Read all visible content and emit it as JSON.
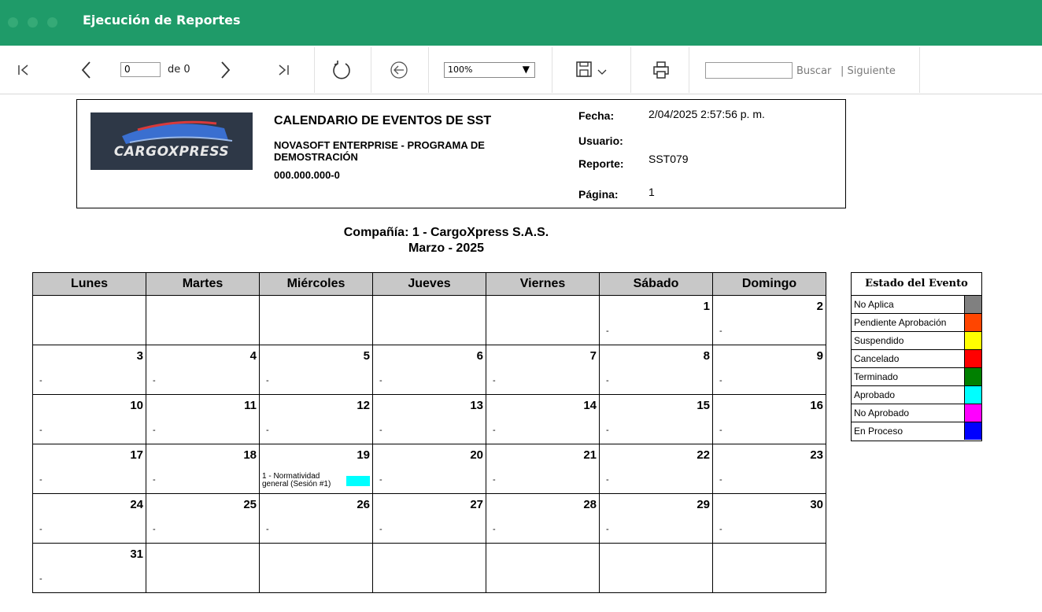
{
  "window": {
    "title": "Ejecución de Reportes"
  },
  "toolbar": {
    "page_value": "0",
    "page_of": "de 0",
    "zoom": "100%",
    "search_placeholder": "",
    "buscar": "Buscar",
    "siguiente": "| Siguiente",
    "icons": [
      "first-page-icon",
      "prev-page-icon",
      "next-page-icon",
      "last-page-icon",
      "refresh-icon",
      "back-icon",
      "save-icon",
      "print-icon"
    ]
  },
  "report": {
    "logo_text": "CARGOXPRESS",
    "title": "CALENDARIO DE EVENTOS DE SST",
    "company_name": "NOVASOFT ENTERPRISE - PROGRAMA DE DEMOSTRACIÓN",
    "nit": "000.000.000-0",
    "fecha_label": "Fecha:",
    "fecha": "2/04/2025 2:57:56 p. m.",
    "usuario_label": "Usuario:",
    "usuario": "",
    "reporte_label": "Reporte:",
    "reporte": "SST079",
    "pagina_label": "Página:",
    "pagina": "1",
    "compania": "Compañía: 1 - CargoXpress S.A.S.",
    "periodo": "Marzo - 2025"
  },
  "calendar": {
    "headers": [
      "Lunes",
      "Martes",
      "Miércoles",
      "Jueves",
      "Viernes",
      "Sábado",
      "Domingo"
    ],
    "weeks": [
      [
        {
          "n": "",
          "d": ""
        },
        {
          "n": "",
          "d": ""
        },
        {
          "n": "",
          "d": ""
        },
        {
          "n": "",
          "d": ""
        },
        {
          "n": "",
          "d": ""
        },
        {
          "n": "1",
          "d": "-"
        },
        {
          "n": "2",
          "d": "-"
        }
      ],
      [
        {
          "n": "3",
          "d": "-"
        },
        {
          "n": "4",
          "d": "-"
        },
        {
          "n": "5",
          "d": "-"
        },
        {
          "n": "6",
          "d": "-"
        },
        {
          "n": "7",
          "d": "-"
        },
        {
          "n": "8",
          "d": "-"
        },
        {
          "n": "9",
          "d": "-"
        }
      ],
      [
        {
          "n": "10",
          "d": "-"
        },
        {
          "n": "11",
          "d": "-"
        },
        {
          "n": "12",
          "d": "-"
        },
        {
          "n": "13",
          "d": "-"
        },
        {
          "n": "14",
          "d": "-"
        },
        {
          "n": "15",
          "d": "-"
        },
        {
          "n": "16",
          "d": "-"
        }
      ],
      [
        {
          "n": "17",
          "d": "-"
        },
        {
          "n": "18",
          "d": "-"
        },
        {
          "n": "19",
          "d": "",
          "event": "1 - Normatividad general (Sesión #1)",
          "event_color": "#00ffff"
        },
        {
          "n": "20",
          "d": "-"
        },
        {
          "n": "21",
          "d": "-"
        },
        {
          "n": "22",
          "d": "-"
        },
        {
          "n": "23",
          "d": "-"
        }
      ],
      [
        {
          "n": "24",
          "d": "-"
        },
        {
          "n": "25",
          "d": "-"
        },
        {
          "n": "26",
          "d": "-"
        },
        {
          "n": "27",
          "d": "-"
        },
        {
          "n": "28",
          "d": "-"
        },
        {
          "n": "29",
          "d": "-"
        },
        {
          "n": "30",
          "d": "-"
        }
      ],
      [
        {
          "n": "31",
          "d": "-"
        },
        {
          "n": "",
          "d": ""
        },
        {
          "n": "",
          "d": ""
        },
        {
          "n": "",
          "d": ""
        },
        {
          "n": "",
          "d": ""
        },
        {
          "n": "",
          "d": ""
        },
        {
          "n": "",
          "d": ""
        }
      ]
    ]
  },
  "legend": {
    "title": "Estado del Evento",
    "items": [
      {
        "label": "No Aplica",
        "color": "#808080"
      },
      {
        "label": "Pendiente Aprobación",
        "color": "#ff4500"
      },
      {
        "label": "Suspendido",
        "color": "#ffff00"
      },
      {
        "label": "Cancelado",
        "color": "#ff0000"
      },
      {
        "label": "Terminado",
        "color": "#008000"
      },
      {
        "label": "Aprobado",
        "color": "#00ffff"
      },
      {
        "label": "No Aprobado",
        "color": "#ff00ff"
      },
      {
        "label": "En Proceso",
        "color": "#0000ff"
      }
    ]
  }
}
